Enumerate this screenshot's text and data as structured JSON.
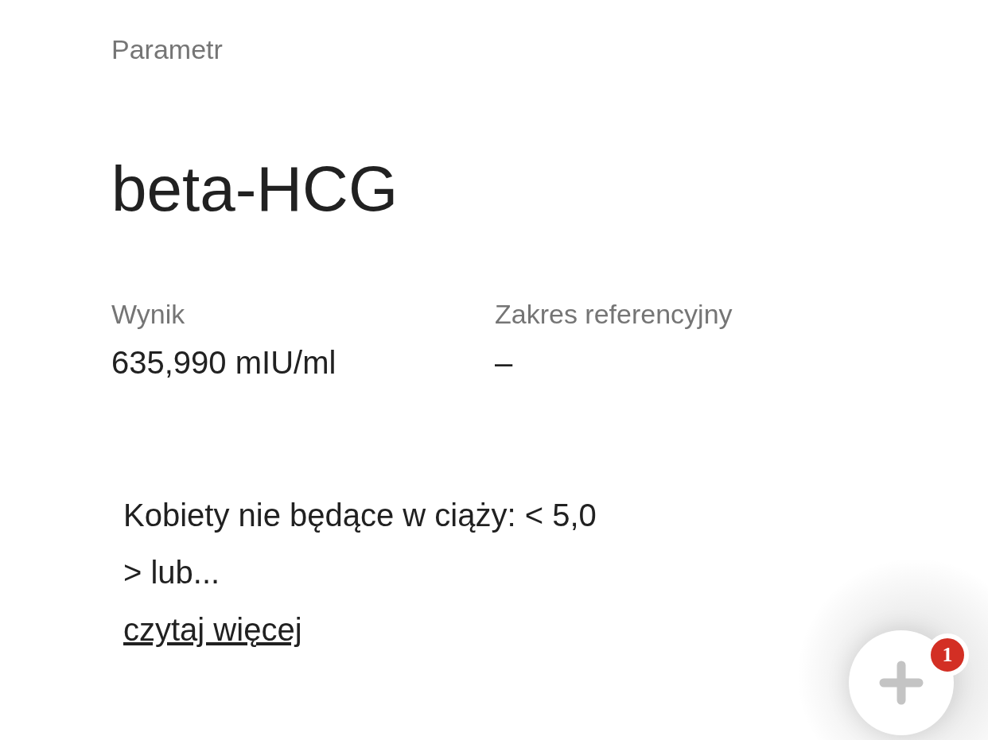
{
  "parameter_label": "Parametr",
  "parameter_name": "beta-HCG",
  "fields": [
    {
      "label": "Wynik",
      "value": "635,990 mIU/ml"
    },
    {
      "label": "Zakres referencyjny",
      "value": "–"
    }
  ],
  "note": "Kobiety nie będące w ciąży: < 5,0\n> lub...",
  "read_more_link": "czytaj więcej",
  "fab": {
    "badge": "1"
  }
}
